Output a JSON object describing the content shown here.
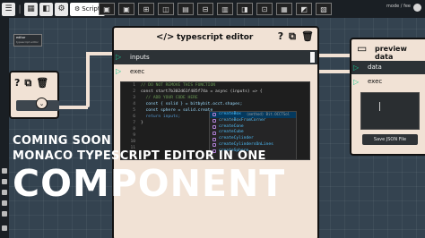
{
  "topbar": {
    "script_tab_label": "Script",
    "right_text": "mode / fee",
    "icons": [
      "menu-icon",
      "grid-icon",
      "cube-icon",
      "settings-icon",
      "gear-icon"
    ],
    "strip_icons": [
      "node-icon",
      "node-icon",
      "node-icon",
      "node-icon",
      "node-icon",
      "node-icon",
      "node-icon",
      "node-icon",
      "node-icon",
      "node-icon",
      "node-icon",
      "node-icon"
    ]
  },
  "editor_panel": {
    "label": "editor",
    "value": "typescript editor"
  },
  "ts_node": {
    "title": "typescript editor",
    "inputs_label": "inputs",
    "exec_label": "exec"
  },
  "code": {
    "lines": [
      {
        "num": "1",
        "text": "// DO NOT REMOVE THIS FUNCTION"
      },
      {
        "num": "2",
        "text": "const start7b302d61f485f74a = async (inputs) => {"
      },
      {
        "num": "3",
        "text": "  // ADD YOUR CODE HERE"
      },
      {
        "num": "4",
        "text": "  const { solid } = bitbybit.occt.shapes;"
      },
      {
        "num": "5",
        "text": "  const sphere = solid.create"
      },
      {
        "num": "6",
        "text": "  return inputs;"
      },
      {
        "num": "7",
        "text": "}"
      },
      {
        "num": "8",
        "text": ""
      },
      {
        "num": "9",
        "text": ""
      },
      {
        "num": "10",
        "text": ""
      },
      {
        "num": "11",
        "text": ""
      },
      {
        "num": "12",
        "text": ""
      }
    ]
  },
  "suggestions": {
    "items": [
      {
        "label": "createBox",
        "detail": "(method) Bit.OCCTSol"
      },
      {
        "label": "createBoxFromCorner",
        "detail": ""
      },
      {
        "label": "createCone",
        "detail": ""
      },
      {
        "label": "createCube",
        "detail": ""
      },
      {
        "label": "createCylinder",
        "detail": ""
      },
      {
        "label": "createCylindersOnLines",
        "detail": ""
      },
      {
        "label": "createSphere",
        "detail": ""
      }
    ]
  },
  "preview_node": {
    "title": "preview data",
    "data_label": "data",
    "exec_label": "exec",
    "save_button": "Save JSON File"
  },
  "overlay": {
    "line1": "COMING SOON",
    "line2": "MONACO TYPESCRIPT EDITOR IN ONE",
    "line3": "COMPONENT"
  },
  "colors": {
    "node_bg": "#f1e2d5",
    "port_dark": "#2c3236",
    "exec_green": "#18c38d",
    "canvas": "#344350"
  }
}
